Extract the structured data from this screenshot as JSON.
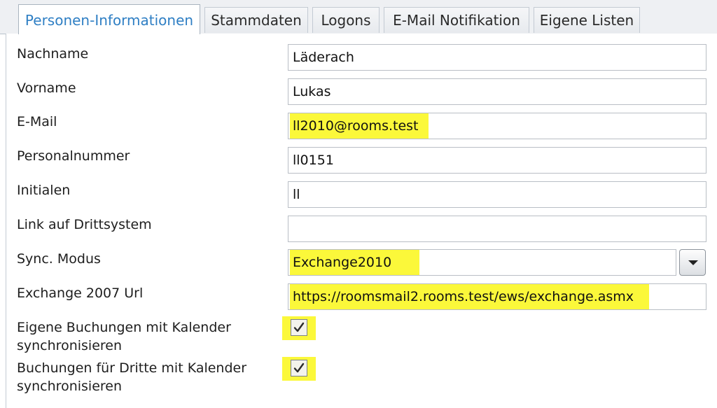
{
  "tabs": [
    {
      "label": "Personen-Informationen",
      "active": true
    },
    {
      "label": "Stammdaten"
    },
    {
      "label": "Logons"
    },
    {
      "label": "E-Mail Notifikation"
    },
    {
      "label": "Eigene Listen"
    }
  ],
  "form": {
    "nachname": {
      "label": "Nachname",
      "value": "Läderach"
    },
    "vorname": {
      "label": "Vorname",
      "value": "Lukas"
    },
    "email": {
      "label": "E-Mail",
      "value": "ll2010@rooms.test"
    },
    "personalnummer": {
      "label": "Personalnummer",
      "value": "ll0151"
    },
    "initialen": {
      "label": "Initialen",
      "value": "ll"
    },
    "link": {
      "label": "Link auf Drittsystem",
      "value": ""
    },
    "sync_modus": {
      "label": "Sync. Modus",
      "value": "Exchange2010"
    },
    "exchange_url": {
      "label": "Exchange 2007 Url",
      "value": "https://roomsmail2.rooms.test/ews/exchange.asmx"
    },
    "eigene_buchungen": {
      "label_line1": "Eigene Buchungen mit Kalender",
      "label_line2": "synchronisieren",
      "checked": true
    },
    "buchungen_dritte": {
      "label_line1": "Buchungen für Dritte mit Kalender",
      "label_line2": "synchronisieren",
      "checked": true
    }
  },
  "colors": {
    "highlight": "#fbf83a",
    "active_tab_text": "#2f7fc4"
  },
  "icons": {
    "dropdown": "chevron-down-icon",
    "checkbox": "checkmark-icon"
  }
}
